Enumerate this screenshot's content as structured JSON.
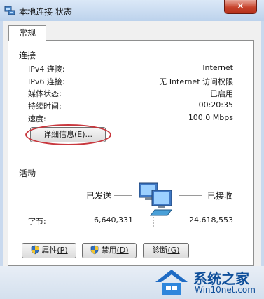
{
  "window": {
    "title": "本地连接 状态",
    "close_glyph": "✕"
  },
  "tabs": [
    {
      "label": "常规"
    }
  ],
  "connection": {
    "section_label": "连接",
    "rows": [
      {
        "label": "IPv4 连接:",
        "value": "Internet"
      },
      {
        "label": "IPv6 连接:",
        "value": "无 Internet 访问权限"
      },
      {
        "label": "媒体状态:",
        "value": "已启用"
      },
      {
        "label": "持续时间:",
        "value": "00:20:35"
      },
      {
        "label": "速度:",
        "value": "100.0 Mbps"
      }
    ],
    "details_button": {
      "label": "详细信息",
      "hotkey": "(E)",
      "suffix": "..."
    }
  },
  "activity": {
    "section_label": "活动",
    "sent_label": "已发送",
    "received_label": "已接收",
    "bytes_label": "字节:",
    "bytes_sent": "6,640,331",
    "bytes_received": "24,618,553"
  },
  "buttons": {
    "properties": {
      "label": "属性",
      "hotkey": "(P)"
    },
    "disable": {
      "label": "禁用",
      "hotkey": "(D)"
    },
    "diagnose": {
      "label": "诊断",
      "hotkey": "(G)"
    }
  },
  "watermark": {
    "line1": "系统之家",
    "line2": "Win10net.com"
  },
  "colors": {
    "highlight_oval": "#c8373d",
    "titlebar": "#c9d9ee",
    "watermark": "#0f4f9a"
  }
}
